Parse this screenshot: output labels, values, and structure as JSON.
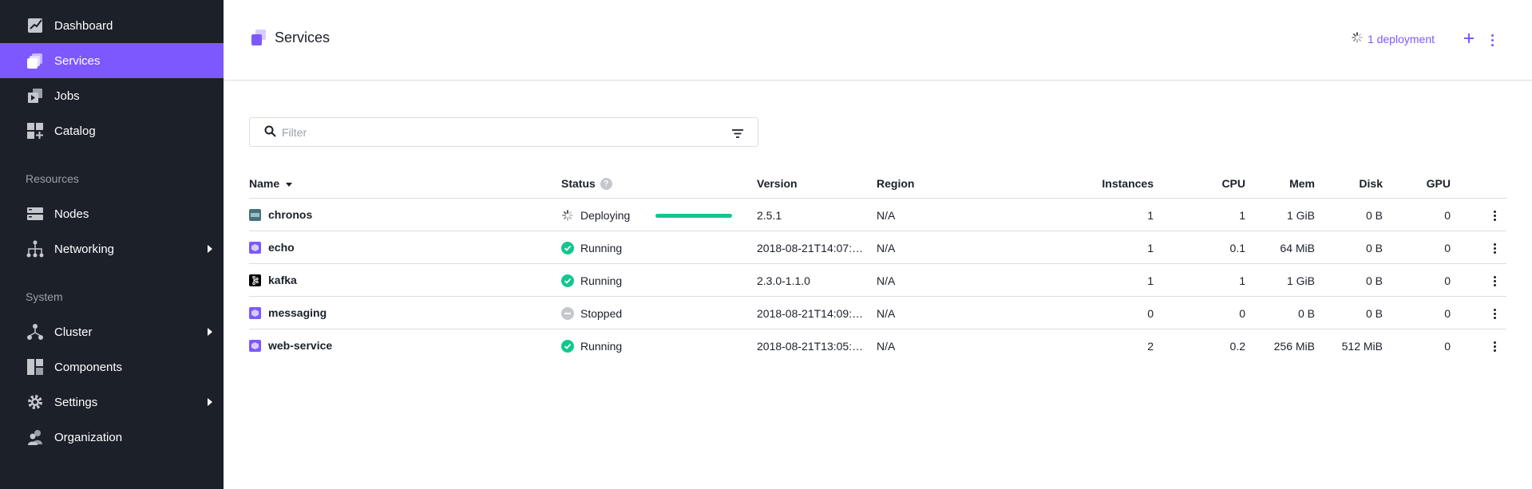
{
  "sidebar": {
    "items": [
      {
        "label": "Dashboard",
        "icon": "dashboard-icon"
      },
      {
        "label": "Services",
        "icon": "services-icon",
        "active": true
      },
      {
        "label": "Jobs",
        "icon": "jobs-icon"
      },
      {
        "label": "Catalog",
        "icon": "catalog-icon"
      }
    ],
    "resources_title": "Resources",
    "resources": [
      {
        "label": "Nodes",
        "icon": "nodes-icon"
      },
      {
        "label": "Networking",
        "icon": "networking-icon",
        "expandable": true
      }
    ],
    "system_title": "System",
    "system": [
      {
        "label": "Cluster",
        "icon": "cluster-icon",
        "expandable": true
      },
      {
        "label": "Components",
        "icon": "components-icon"
      },
      {
        "label": "Settings",
        "icon": "gear-icon",
        "expandable": true
      },
      {
        "label": "Organization",
        "icon": "organization-icon"
      }
    ]
  },
  "header": {
    "title": "Services",
    "deployments_link": "1 deployment"
  },
  "filter": {
    "placeholder": "Filter"
  },
  "table": {
    "columns": {
      "name": "Name",
      "status": "Status",
      "version": "Version",
      "region": "Region",
      "instances": "Instances",
      "cpu": "CPU",
      "mem": "Mem",
      "disk": "Disk",
      "gpu": "GPU"
    },
    "rows": [
      {
        "name": "chronos",
        "icon": "chronos-icon",
        "status": "Deploying",
        "version": "2.5.1",
        "region": "N/A",
        "instances": "1",
        "cpu": "1",
        "mem": "1 GiB",
        "disk": "0 B",
        "gpu": "0",
        "progress": 1.0
      },
      {
        "name": "echo",
        "icon": "package-icon",
        "status": "Running",
        "version": "2018-08-21T14:07:…",
        "region": "N/A",
        "instances": "1",
        "cpu": "0.1",
        "mem": "64 MiB",
        "disk": "0 B",
        "gpu": "0"
      },
      {
        "name": "kafka",
        "icon": "kafka-icon",
        "status": "Running",
        "version": "2.3.0-1.1.0",
        "region": "N/A",
        "instances": "1",
        "cpu": "1",
        "mem": "1 GiB",
        "disk": "0 B",
        "gpu": "0"
      },
      {
        "name": "messaging",
        "icon": "package-icon",
        "status": "Stopped",
        "version": "2018-08-21T14:09:…",
        "region": "N/A",
        "instances": "0",
        "cpu": "0",
        "mem": "0 B",
        "disk": "0 B",
        "gpu": "0"
      },
      {
        "name": "web-service",
        "icon": "package-icon",
        "status": "Running",
        "version": "2018-08-21T13:05:…",
        "region": "N/A",
        "instances": "2",
        "cpu": "0.2",
        "mem": "256 MiB",
        "disk": "512 MiB",
        "gpu": "0"
      }
    ]
  },
  "colors": {
    "accent": "#7d58ff",
    "sidebar_bg": "#1b2029",
    "running": "#12c78f",
    "stopped": "#c4c7cc"
  }
}
